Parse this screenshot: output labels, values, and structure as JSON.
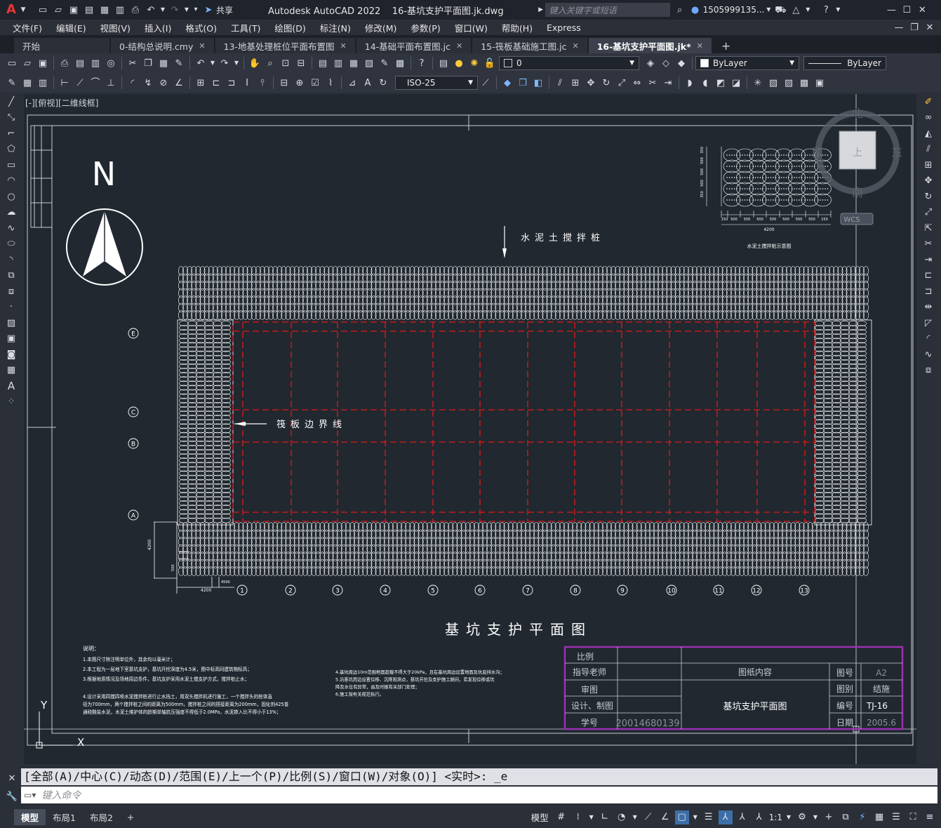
{
  "app": {
    "logo": "A",
    "title": "Autodesk AutoCAD 2022",
    "filename": "16-基坑支护平面图.jk.dwg",
    "search_placeholder": "键入关键字或短语",
    "user": "1505999135...",
    "share_label": "共享"
  },
  "menu": [
    "文件(F)",
    "编辑(E)",
    "视图(V)",
    "插入(I)",
    "格式(O)",
    "工具(T)",
    "绘图(D)",
    "标注(N)",
    "修改(M)",
    "参数(P)",
    "窗口(W)",
    "帮助(H)",
    "Express"
  ],
  "tabs": [
    {
      "label": "开始",
      "closable": false,
      "active": false
    },
    {
      "label": "0-结构总说明.cmy",
      "closable": true,
      "active": false
    },
    {
      "label": "13-地基处理桩位平面布置图",
      "closable": true,
      "active": false
    },
    {
      "label": "14-基础平面布置图.jc",
      "closable": true,
      "active": false
    },
    {
      "label": "15-筏板基础施工图.jc",
      "closable": true,
      "active": false
    },
    {
      "label": "16-基坑支护平面图.jk*",
      "closable": true,
      "active": true
    }
  ],
  "toolbar": {
    "layer_value": "0",
    "color_value": "ByLayer",
    "linetype_value": "ByLayer",
    "dimstyle_value": "ISO-25"
  },
  "viewport": {
    "label": "[-][俯视][二维线框]",
    "viewcube": {
      "north": "北",
      "south": "南",
      "east": "东",
      "west": "西",
      "top": "上",
      "wcs": "WCS"
    }
  },
  "drawing": {
    "north_letter": "N",
    "title": "基坑支护平面图",
    "pile_label": "水泥土搅拌桩",
    "raft_label": "筏板边界线",
    "detail_caption": "水泥土搅拌桩示意图",
    "detail_dims": [
      "150",
      "500",
      "500",
      "500",
      "500",
      "500",
      "500",
      "500",
      "150"
    ],
    "detail_total": "4200",
    "detail_side_dims": [
      "350",
      "500",
      "500",
      "500",
      "350"
    ],
    "row_axes": [
      "E",
      "C",
      "B",
      "A"
    ],
    "col_axes": [
      "1",
      "2",
      "3",
      "4",
      "5",
      "6",
      "7",
      "8",
      "9",
      "10",
      "11",
      "12",
      "13"
    ],
    "dim_corner_vertical": "4200",
    "dim_corner_bottom": "4200",
    "dim_small_1": "500",
    "dim_small_2": "4500",
    "notes_left": [
      "说明：",
      "1.本图尺寸除注明单位外，其余均以毫米计；",
      "2.本工程为一层地下室基坑支护，基坑开挖深度为4.5米，图中标高同建筑物标高；",
      "3.根据地质情况及场地周边条件，基坑支护采用水泥土搅支护方式，搅拌桩止水；",
      "4.设计采用四搅四喷水泥搅拌桩进行止水挡土，用双头搅拌机进行施工，一个搅拌头的桩体直",
      "径为700mm，两个搅拌桩之间的距离为500mm，搅拌桩之间的搭接距离为200mm，固化剂425普",
      "通硅酸盐水泥，水泥土维护体的龄期单轴抗压强度不得低于2.0MPa，水泥掺入比不得小于13%；"
    ],
    "notes_right": [
      "4.基坑周边10m范围地面超载不得大于20kPa，且在基坑周边设置地面及坑底排水沟；",
      "5.沿基坑周边设置位移、沉降观测点，基坑开挖及支护施工期间，若发现位移或坑",
      "   降及水位有异常，由及时报有关部门处理；",
      "6.施工按有关规范执行。"
    ],
    "axis_y": "Y",
    "axis_x": "X"
  },
  "title_block": {
    "scale_label": "比例",
    "advisor_label": "指导老师",
    "review_label": "审图",
    "design_label": "设计、制图",
    "student_id_label": "学号",
    "student_id_value": "20014680139",
    "content_label": "图纸内容",
    "content_value": "基坑支护平面图",
    "drawing_no_label": "图号",
    "drawing_no_value": "A2",
    "category_label": "图别",
    "category_value": "结施",
    "number_label": "编号",
    "number_value": "TJ-16",
    "date_label": "日期",
    "date_value": "2005.6"
  },
  "command": {
    "history": "[全部(A)/中心(C)/动态(D)/范围(E)/上一个(P)/比例(S)/窗口(W)/对象(O)] <实时>: _e",
    "placeholder": "键入命令"
  },
  "status": {
    "layout_tabs": [
      "模型",
      "布局1",
      "布局2"
    ],
    "model_label": "模型",
    "scale_label": "1:1"
  },
  "colors": {
    "canvas": "#212830",
    "drawing_lines": "#ffffff",
    "raft_grid": "#e01818",
    "title_block_border": "#9b2fb4"
  }
}
